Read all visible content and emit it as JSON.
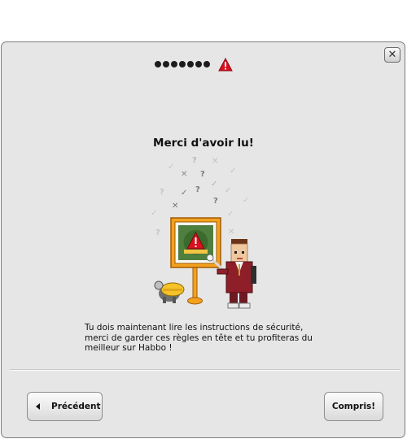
{
  "dialog": {
    "close_icon": "close-icon",
    "progress": {
      "completed_steps": 7,
      "current_step_icon": "warning-icon"
    },
    "title": "Merci d'avoir lu!",
    "illustration": "habbo-safety-instructor",
    "description": "Tu dois maintenant lire les instructions de sécurité, merci de garder ces règles en tête et tu profiteras du meilleur sur Habbo !",
    "buttons": {
      "previous_label": "Précédent",
      "previous_icon": "arrow-left-icon",
      "confirm_label": "Compris!"
    }
  },
  "colors": {
    "dialog_bg": "#e6e6e6",
    "warning_red": "#d6121f",
    "board_frame": "#f4a21d",
    "board_green": "#4f7f3f",
    "uniform_red": "#8e1f28"
  }
}
